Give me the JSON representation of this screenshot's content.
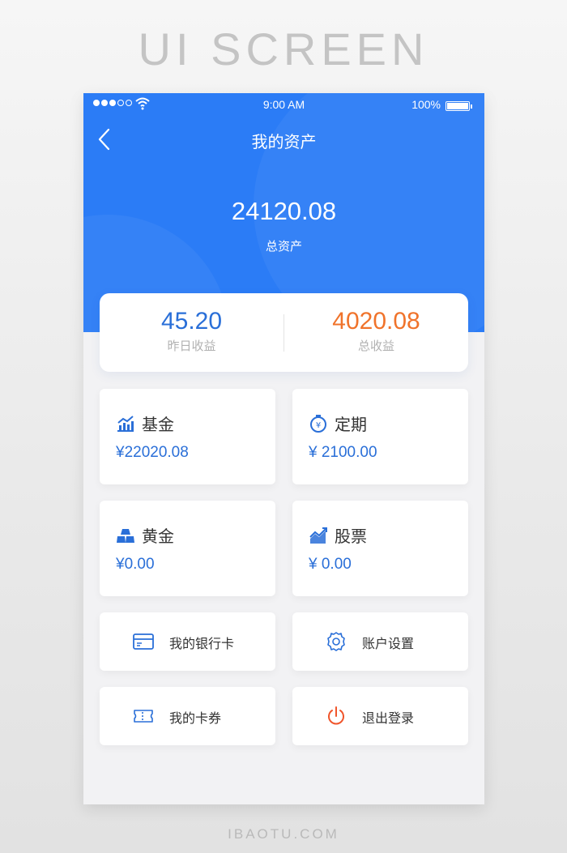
{
  "banner": "UI SCREEN",
  "footer": "IBAOTU.COM",
  "status": {
    "time": "9:00 AM",
    "battery": "100%"
  },
  "nav": {
    "title": "我的资产"
  },
  "assets": {
    "total": "24120.08",
    "total_label": "总资产"
  },
  "summary": {
    "yesterday": {
      "value": "45.20",
      "label": "昨日收益"
    },
    "total": {
      "value": "4020.08",
      "label": "总收益"
    }
  },
  "cards": [
    {
      "name": "基金",
      "amount": "¥22020.08",
      "icon": "line-chart-icon"
    },
    {
      "name": "定期",
      "amount": "¥ 2100.00",
      "icon": "stopwatch-yen-icon"
    },
    {
      "name": "黄金",
      "amount": "¥0.00",
      "icon": "gold-bars-icon"
    },
    {
      "name": "股票",
      "amount": "¥ 0.00",
      "icon": "trend-up-icon"
    }
  ],
  "menu": [
    {
      "label": "我的银行卡",
      "icon": "bank-card-icon"
    },
    {
      "label": "账户设置",
      "icon": "gear-icon"
    },
    {
      "label": "我的卡券",
      "icon": "coupon-icon"
    },
    {
      "label": "退出登录",
      "icon": "power-icon"
    }
  ],
  "colors": {
    "primary": "#2b7cf6",
    "accent_blue": "#2a6fd8",
    "accent_orange": "#f0732b",
    "logout": "#f0552b"
  }
}
